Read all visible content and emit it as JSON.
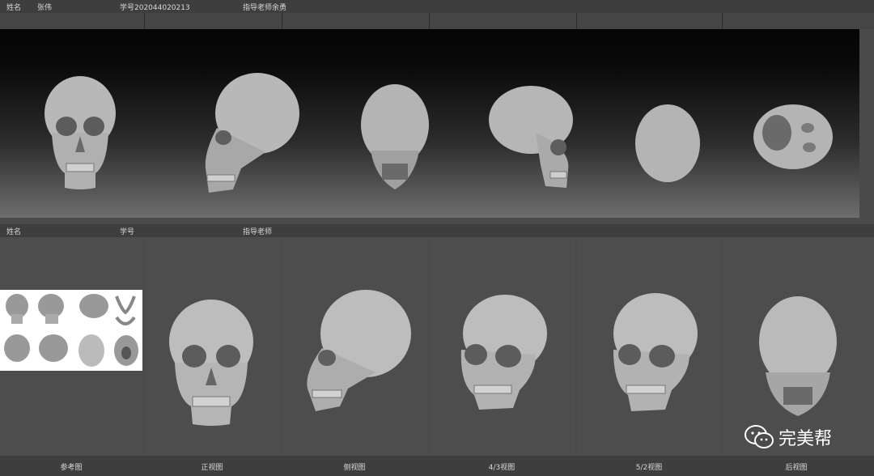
{
  "top_bar": {
    "name_label": "姓名",
    "name_value": "张伟",
    "student_id": "学号202044020213",
    "teacher": "指导老师余勇"
  },
  "mid_bar": {
    "name_label": "姓名",
    "student_id_label": "学号",
    "teacher_label": "指导老师"
  },
  "captions": {
    "reference": "参考图",
    "front": "正视图",
    "side": "侧视图",
    "three_quarter_4": "4/3视图",
    "three_quarter_5": "5/2视图",
    "back": "后视图"
  },
  "watermark": {
    "text": "完美帮",
    "icon": "wechat-icon"
  },
  "colors": {
    "skull": "#b8b8b8",
    "skull_shadow": "#6f6f6f",
    "background": "#4a4a4a"
  }
}
